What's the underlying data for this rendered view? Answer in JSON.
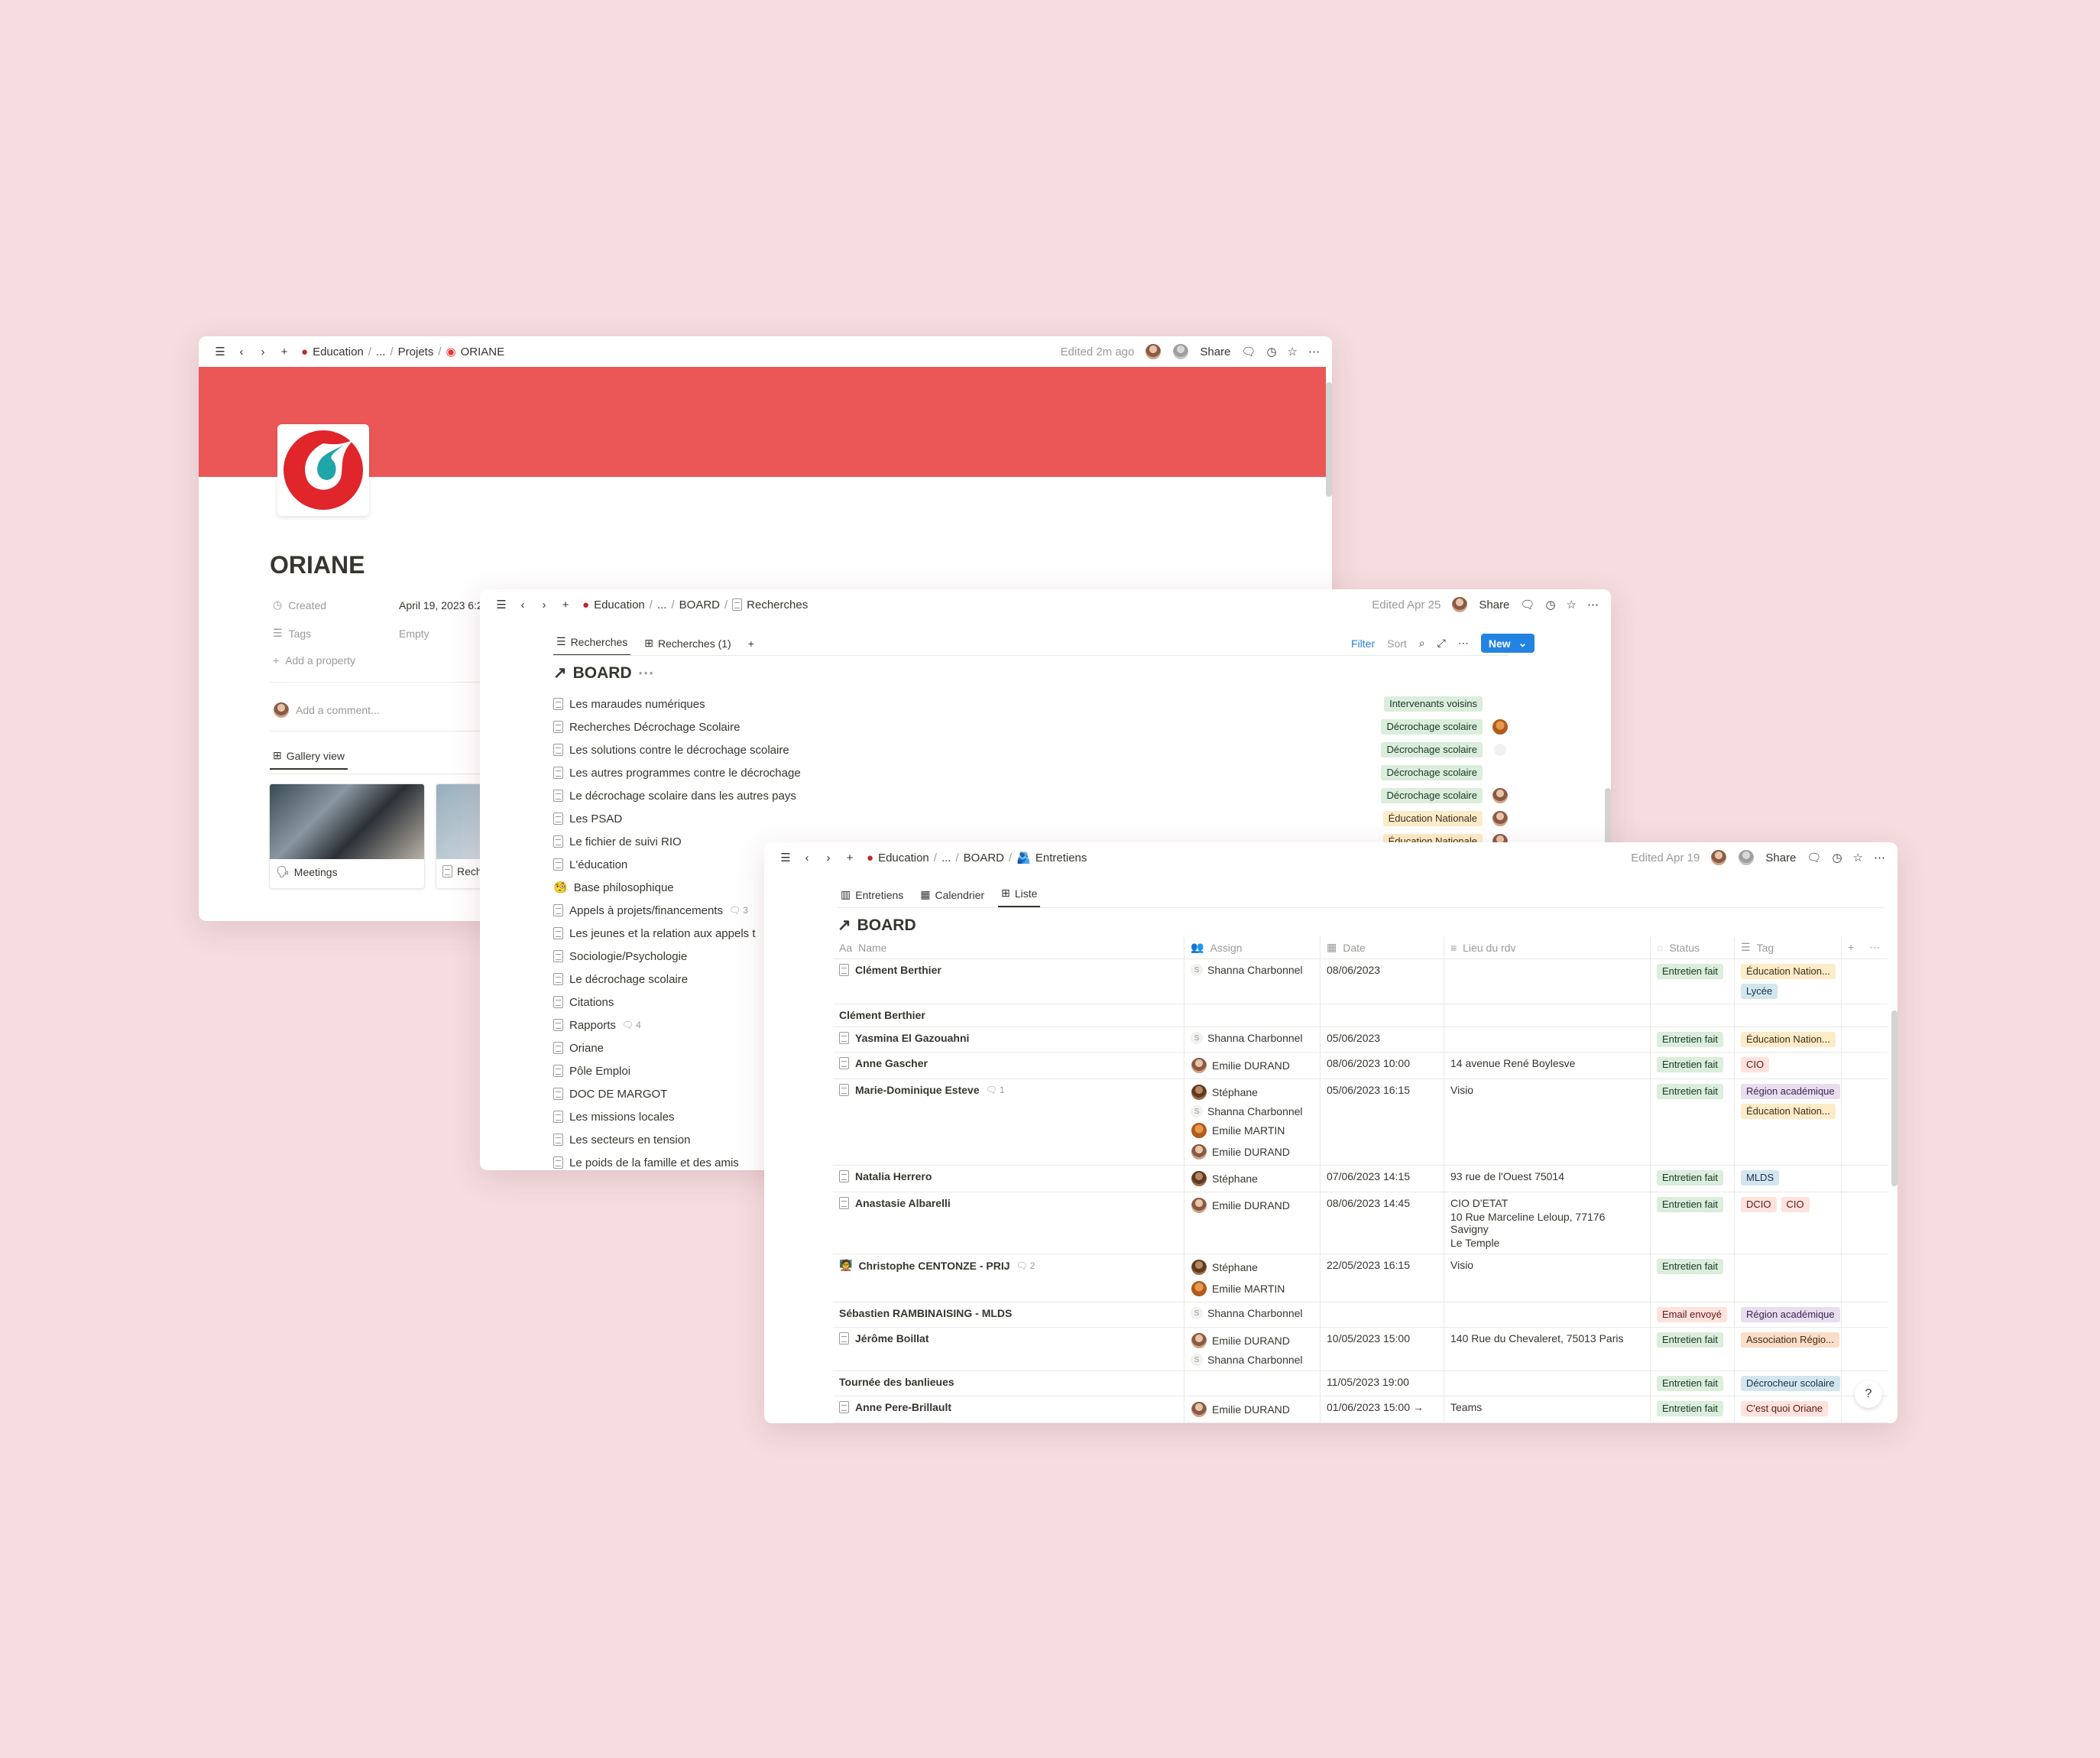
{
  "colors": {
    "background": "#f5dde0",
    "cover": "#eb5757",
    "accent": "#2383e2"
  },
  "window_oriane": {
    "breadcrumb": [
      "Education",
      "...",
      "Projets",
      "ORIANE"
    ],
    "edited": "Edited 2m ago",
    "share": "Share",
    "title": "ORIANE",
    "props": {
      "created_label": "Created",
      "created_value": "April 19, 2023 6:2!",
      "tags_label": "Tags",
      "tags_value": "Empty",
      "add_property": "Add a property"
    },
    "comment_placeholder": "Add a comment...",
    "view_tab": "Gallery view",
    "cards": [
      "Meetings",
      "Rech"
    ]
  },
  "window_recherches": {
    "breadcrumb": [
      "Education",
      "...",
      "BOARD",
      "Recherches"
    ],
    "edited": "Edited Apr 25",
    "share": "Share",
    "tabs": [
      "Recherches",
      "Recherches (1)"
    ],
    "toolbar": {
      "filter": "Filter",
      "sort": "Sort",
      "new": "New"
    },
    "title": "BOARD",
    "items": [
      {
        "label": "Les maraudes numériques",
        "tag": "Intervenants voisins",
        "tag_color": "green"
      },
      {
        "label": "Recherches Décrochage Scolaire",
        "tag": "Décrochage scolaire",
        "tag_color": "green",
        "avatar": "av4"
      },
      {
        "label": "Les solutions contre le décrochage scolaire",
        "tag": "Décrochage scolaire",
        "tag_color": "green",
        "avatar": "ini"
      },
      {
        "label": "Les autres programmes contre le décrochage",
        "tag": "Décrochage scolaire",
        "tag_color": "green"
      },
      {
        "label": "Le décrochage scolaire dans les autres pays",
        "tag": "Décrochage scolaire",
        "tag_color": "green",
        "avatar": "av"
      },
      {
        "label": "Les PSAD",
        "tag": "Éducation Nationale",
        "tag_color": "yellow",
        "avatar": "av"
      },
      {
        "label": "Le fichier de suivi RIO",
        "tag": "Éducation Nationale",
        "tag_color": "yellow",
        "avatar": "av"
      },
      {
        "label": "L'éducation"
      },
      {
        "label": "Base philosophique",
        "emoji": "🧐"
      },
      {
        "label": "Appels à projets/financements",
        "comments": "3"
      },
      {
        "label": "Les jeunes et la relation aux appels t"
      },
      {
        "label": "Sociologie/Psychologie"
      },
      {
        "label": "Le décrochage scolaire"
      },
      {
        "label": "Citations"
      },
      {
        "label": "Rapports",
        "comments": "4"
      },
      {
        "label": "Oriane"
      },
      {
        "label": "Pôle Emploi"
      },
      {
        "label": "DOC DE MARGOT"
      },
      {
        "label": "Les missions locales"
      },
      {
        "label": "Les secteurs en tension"
      },
      {
        "label": "Le poids de la famille et des amis"
      }
    ]
  },
  "window_entretiens": {
    "breadcrumb": [
      "Education",
      "...",
      "BOARD",
      "Entretiens"
    ],
    "edited": "Edited Apr 19",
    "share": "Share",
    "tabs": [
      "Entretiens",
      "Calendrier",
      "Liste"
    ],
    "title": "BOARD",
    "columns": [
      "Name",
      "Assign",
      "Date",
      "Lieu du rdv",
      "Status",
      "Tag"
    ],
    "rows": [
      {
        "name": "Clément Berthier",
        "doc": true,
        "assign": [
          {
            "n": "Shanna Charbonnel",
            "a": "ini",
            "i": "S"
          }
        ],
        "date": "08/06/2023",
        "lieu": [],
        "status": {
          "t": "Entretien fait",
          "c": "green"
        },
        "tags": [
          {
            "t": "Éducation Nation...",
            "c": "yellow"
          },
          {
            "t": "Lycée",
            "c": "blue"
          }
        ]
      },
      {
        "name": "Clément Berthier",
        "doc": false,
        "assign": [],
        "date": "",
        "lieu": [],
        "tags": []
      },
      {
        "name": "Yasmina El Gazouahni",
        "doc": true,
        "assign": [
          {
            "n": "Shanna Charbonnel",
            "a": "ini",
            "i": "S"
          }
        ],
        "date": "05/06/2023",
        "lieu": [],
        "status": {
          "t": "Entretien fait",
          "c": "green"
        },
        "tags": [
          {
            "t": "Éducation Nation...",
            "c": "yellow"
          }
        ]
      },
      {
        "name": "Anne Gascher",
        "doc": true,
        "assign": [
          {
            "n": "Emilie DURAND",
            "a": "av"
          }
        ],
        "date": "08/06/2023 10:00",
        "lieu": [
          "14 avenue René Boylesve"
        ],
        "status": {
          "t": "Entretien fait",
          "c": "green"
        },
        "tags": [
          {
            "t": "CIO",
            "c": "red"
          }
        ]
      },
      {
        "name": "Marie-Dominique Esteve",
        "doc": true,
        "comments": "1",
        "assign": [
          {
            "n": "Stéphane",
            "a": "av3"
          },
          {
            "n": "Shanna Charbonnel",
            "a": "ini",
            "i": "S"
          },
          {
            "n": "Emilie MARTIN",
            "a": "av4"
          },
          {
            "n": "Emilie DURAND",
            "a": "av"
          }
        ],
        "date": "05/06/2023 16:15",
        "lieu": [
          "Visio"
        ],
        "status": {
          "t": "Entretien fait",
          "c": "green"
        },
        "tags": [
          {
            "t": "Région académique",
            "c": "purple"
          },
          {
            "t": "Éducation Nation...",
            "c": "yellow"
          }
        ]
      },
      {
        "name": "Natalia Herrero",
        "doc": true,
        "assign": [
          {
            "n": "Stéphane",
            "a": "av3"
          }
        ],
        "date": "07/06/2023 14:15",
        "lieu": [
          "93 rue de l'Ouest 75014"
        ],
        "status": {
          "t": "Entretien fait",
          "c": "green"
        },
        "tags": [
          {
            "t": "MLDS",
            "c": "blue"
          }
        ]
      },
      {
        "name": "Anastasie Albarelli",
        "doc": true,
        "assign": [
          {
            "n": "Emilie DURAND",
            "a": "av"
          }
        ],
        "date": "08/06/2023 14:45",
        "lieu": [
          "CIO D'ETAT",
          "10 Rue Marceline Leloup, 77176 Savigny",
          "Le Temple"
        ],
        "status": {
          "t": "Entretien fait",
          "c": "green"
        },
        "tags": [
          {
            "t": "DCIO",
            "c": "red"
          },
          {
            "t": "CIO",
            "c": "red"
          }
        ]
      },
      {
        "name": "Christophe CENTONZE - PRIJ",
        "emoji": "🧑‍🏫",
        "comments": "2",
        "assign": [
          {
            "n": "Stéphane",
            "a": "av3"
          },
          {
            "n": "Emilie MARTIN",
            "a": "av4"
          }
        ],
        "date": "22/05/2023 16:15",
        "lieu": [
          "Visio"
        ],
        "status": {
          "t": "Entretien fait",
          "c": "green"
        },
        "tags": []
      },
      {
        "name": "Sébastien RAMBINAISING - MLDS",
        "doc": false,
        "assign": [
          {
            "n": "Shanna Charbonnel",
            "a": "ini",
            "i": "S"
          }
        ],
        "date": "",
        "lieu": [],
        "status": {
          "t": "Email envoyé",
          "c": "red"
        },
        "tags": [
          {
            "t": "Région académique",
            "c": "purple"
          }
        ]
      },
      {
        "name": "Jérôme Boillat",
        "doc": true,
        "assign": [
          {
            "n": "Emilie DURAND",
            "a": "av"
          },
          {
            "n": "Shanna Charbonnel",
            "a": "ini",
            "i": "S"
          }
        ],
        "date": "10/05/2023 15:00",
        "lieu": [
          "140 Rue du Chevaleret, 75013 Paris"
        ],
        "status": {
          "t": "Entretien fait",
          "c": "green"
        },
        "tags": [
          {
            "t": "Association Régio...",
            "c": "orange"
          }
        ]
      },
      {
        "name": "Tournée des banlieues",
        "doc": false,
        "assign": [],
        "date": "11/05/2023 19:00",
        "lieu": [],
        "status": {
          "t": "Entretien fait",
          "c": "green"
        },
        "tags": [
          {
            "t": "Décrocheur scolaire",
            "c": "blue"
          }
        ]
      },
      {
        "name": "Anne Pere-Brillault",
        "doc": true,
        "assign": [
          {
            "n": "Emilie DURAND",
            "a": "av"
          }
        ],
        "date": "01/06/2023 15:00 →",
        "lieu": [
          "Teams"
        ],
        "status": {
          "t": "Entretien fait",
          "c": "green"
        },
        "tags": [
          {
            "t": "C'est quoi Oriane",
            "c": "red"
          }
        ]
      }
    ]
  }
}
